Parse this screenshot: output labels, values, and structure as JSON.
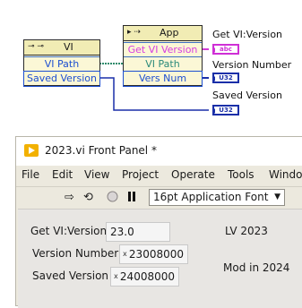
{
  "block_diagram": {
    "vi_node": {
      "title": "VI",
      "icon": "⊸ ⊸",
      "rows": [
        "VI Path",
        "Saved Version"
      ]
    },
    "app_node": {
      "title": "App",
      "icon": "▸ ⇢",
      "rows": [
        "Get VI Version",
        "VI Path",
        "Vers Num"
      ]
    },
    "indicators": [
      {
        "label": "Get VI:Version",
        "terminal": "abc"
      },
      {
        "label": "Version Number",
        "terminal": "U32"
      },
      {
        "label": "Saved Version",
        "terminal": "U32"
      }
    ],
    "colors": {
      "string_wire": "#d13dd6",
      "numeric_wire": "#1a2fa8",
      "refnum_wire": "#2e8b6b"
    }
  },
  "front_panel": {
    "title": "2023.vi Front Panel *",
    "menu": [
      "File",
      "Edit",
      "View",
      "Project",
      "Operate",
      "Tools",
      "Windo"
    ],
    "toolbar": {
      "icons": [
        "run-arrow-icon",
        "run-continuous-icon",
        "abort-icon",
        "pause-icon"
      ],
      "font_select": "16pt Application Font"
    },
    "fields": {
      "get_vi_version": {
        "label": "Get VI:Version",
        "value": "23.0"
      },
      "version_number": {
        "label": "Version Number",
        "radix": "x",
        "value": "23008000"
      },
      "saved_version": {
        "label": "Saved Version",
        "radix": "x",
        "value": "24008000"
      }
    },
    "notes": {
      "lv": "LV 2023",
      "mod": "Mod in 2024"
    }
  }
}
